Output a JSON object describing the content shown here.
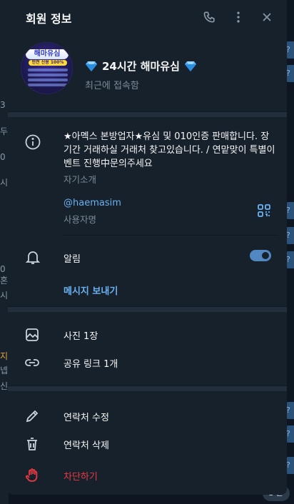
{
  "background": {
    "left_fragments": [
      "3",
      "두",
      "0",
      "시",
      "0혼",
      "시",
      "지",
      "넵",
      "신"
    ],
    "right_fragments": [
      "?",
      "?",
      "?",
      "?",
      "?",
      "?",
      "?",
      "?",
      "?",
      "?",
      "?"
    ],
    "bottom_right_label": "1 안녕"
  },
  "panel": {
    "title": "회원 정보",
    "icons": [
      "phone-icon",
      "more-vertical-icon",
      "close-icon"
    ]
  },
  "profile": {
    "avatar_top_text": "해마유심",
    "avatar_sub_text": "안전 신용 100%",
    "name": "24시간 해마유심",
    "name_emoji": "💎",
    "status": "최근에 접속함"
  },
  "info": {
    "bio": "★아멕스 본방업자★유심 및 010인증 판매합니다. 장기간 거래하실 거래처 찾고있습니다. / 연맡맞이 특별이벤트 진행中문의주세요",
    "bio_label": "자기소개",
    "username": "@haemasim",
    "username_label": "사용자명"
  },
  "notifications": {
    "label": "알림",
    "enabled": true,
    "send_message": "메시지 보내기"
  },
  "media": {
    "photos": "사진 1장",
    "links": "공유 링크 1개"
  },
  "actions": {
    "edit_contact": "연락처 수정",
    "delete_contact": "연락처 삭제",
    "block": "차단하기"
  },
  "colors": {
    "accent": "#6ab2f2",
    "toggle": "#5288c1",
    "danger": "#ec3942",
    "panel_bg": "#17212b"
  }
}
